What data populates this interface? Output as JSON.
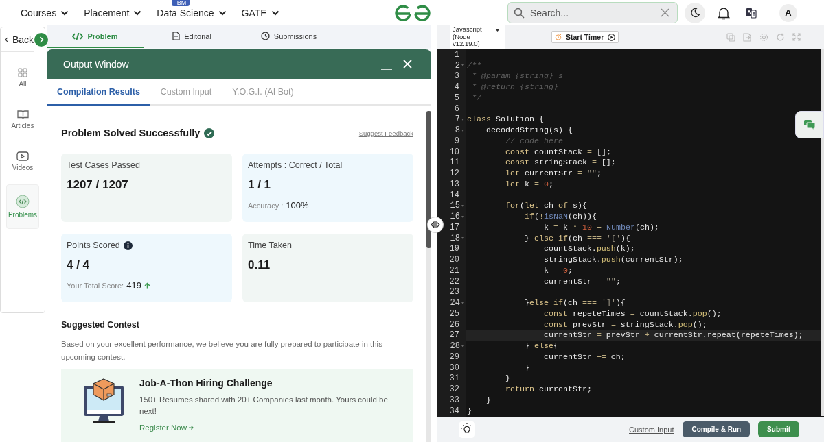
{
  "top_nav": {
    "items": [
      {
        "label": "Courses"
      },
      {
        "label": "Placement"
      },
      {
        "label": "Data Science",
        "badge": "IBM"
      },
      {
        "label": "GATE"
      }
    ],
    "search": {
      "placeholder": "Search..."
    },
    "avatar": "A"
  },
  "sidebar": {
    "back": "Back",
    "items": [
      {
        "label": "All",
        "selected": false
      },
      {
        "label": "Articles",
        "selected": false
      },
      {
        "label": "Videos",
        "selected": false
      },
      {
        "label": "Problems",
        "selected": true
      }
    ]
  },
  "problem_tabs": [
    {
      "label": "Problem",
      "selected": true
    },
    {
      "label": "Editorial",
      "selected": false
    },
    {
      "label": "Submissions",
      "selected": false
    }
  ],
  "output_window": {
    "title": "Output Window",
    "tabs": [
      {
        "label": "Compilation Results",
        "selected": true
      },
      {
        "label": "Custom Input",
        "selected": false
      },
      {
        "label": "Y.O.G.I. (AI Bot)",
        "selected": false
      }
    ],
    "status": "Problem Solved Successfully",
    "feedback_link": "Suggest Feedback",
    "stats": [
      {
        "label": "Test Cases Passed",
        "value": "1207 / 1207",
        "color": "#f1f6f4",
        "info": false
      },
      {
        "label": "Attempts : Correct / Total",
        "value": "1 / 1",
        "color": "#eef8fd",
        "info": false,
        "note_label": "Accuracy :",
        "note_value": "100%"
      },
      {
        "label": "Points Scored",
        "value": "4 / 4",
        "color": "#eef8fd",
        "info": true,
        "note_label": "Your Total Score:",
        "note_value": "419",
        "rising": true
      },
      {
        "label": "Time Taken",
        "value": "0.11",
        "color": "#f1f6f4",
        "info": false
      }
    ],
    "suggested": {
      "title": "Suggested Contest",
      "text": "Based on your excellent performance, we believe you are fully prepared to participate in this upcoming contest.",
      "contest": {
        "title": "Job-A-Thon Hiring Challenge",
        "description": "150+ Resumes shared with 20+ Companies last month. Yours could be next!",
        "link": "Register Now"
      }
    }
  },
  "editor": {
    "language": "Javascript (Node v12.19.0)",
    "timer_button": "Start Timer",
    "lines": [
      {
        "number": "1",
        "foldable": false,
        "current": false
      },
      {
        "number": "2",
        "foldable": true,
        "current": false,
        "tokens": [
          {
            "text": "/**",
            "kind": "comment"
          }
        ]
      },
      {
        "number": "3",
        "foldable": false,
        "current": false,
        "tokens": [
          {
            "text": " * @param {string} s",
            "kind": "comment"
          }
        ]
      },
      {
        "number": "4",
        "foldable": false,
        "current": false,
        "tokens": [
          {
            "text": " * @return {string}",
            "kind": "comment"
          }
        ]
      },
      {
        "number": "5",
        "foldable": false,
        "current": false,
        "tokens": [
          {
            "text": " */",
            "kind": "comment"
          }
        ]
      },
      {
        "number": "6",
        "foldable": false,
        "current": false
      },
      {
        "number": "7",
        "foldable": true,
        "current": false,
        "tokens": [
          {
            "text": "class",
            "kind": "keyword"
          },
          {
            "text": " Solution {",
            "kind": "plain"
          }
        ]
      },
      {
        "number": "8",
        "foldable": true,
        "current": false,
        "tokens": [
          {
            "text": "    decodedString(s) {",
            "kind": "plain"
          }
        ]
      },
      {
        "number": "9",
        "foldable": false,
        "current": false,
        "tokens": [
          {
            "text": "        // code here",
            "kind": "comment"
          }
        ]
      },
      {
        "number": "10",
        "foldable": false,
        "current": false,
        "tokens": [
          {
            "text": "        const",
            "kind": "keyword"
          },
          {
            "text": " countStack ",
            "kind": "plain"
          },
          {
            "text": "=",
            "kind": "op"
          },
          {
            "text": " [];",
            "kind": "plain"
          }
        ]
      },
      {
        "number": "11",
        "foldable": false,
        "current": false,
        "tokens": [
          {
            "text": "        const",
            "kind": "keyword"
          },
          {
            "text": " stringStack ",
            "kind": "plain"
          },
          {
            "text": "=",
            "kind": "op"
          },
          {
            "text": " [];",
            "kind": "plain"
          }
        ]
      },
      {
        "number": "12",
        "foldable": false,
        "current": false,
        "tokens": [
          {
            "text": "        let",
            "kind": "keyword"
          },
          {
            "text": " currentStr ",
            "kind": "plain"
          },
          {
            "text": "=",
            "kind": "op"
          },
          {
            "text": " \"\"",
            "kind": "string"
          },
          {
            "text": ";",
            "kind": "plain"
          }
        ]
      },
      {
        "number": "13",
        "foldable": false,
        "current": false,
        "tokens": [
          {
            "text": "        let",
            "kind": "keyword"
          },
          {
            "text": " k ",
            "kind": "plain"
          },
          {
            "text": "=",
            "kind": "op"
          },
          {
            "text": " 0",
            "kind": "number"
          },
          {
            "text": ";",
            "kind": "plain"
          }
        ]
      },
      {
        "number": "14",
        "foldable": false,
        "current": false
      },
      {
        "number": "15",
        "foldable": true,
        "current": false,
        "tokens": [
          {
            "text": "        for",
            "kind": "keyword"
          },
          {
            "text": "(",
            "kind": "plain"
          },
          {
            "text": "let",
            "kind": "keyword"
          },
          {
            "text": " ch ",
            "kind": "plain"
          },
          {
            "text": "of",
            "kind": "keyword"
          },
          {
            "text": " s){",
            "kind": "plain"
          }
        ]
      },
      {
        "number": "16",
        "foldable": true,
        "current": false,
        "tokens": [
          {
            "text": "            if",
            "kind": "keyword"
          },
          {
            "text": "(",
            "kind": "plain"
          },
          {
            "text": "!",
            "kind": "op"
          },
          {
            "text": "isNaN",
            "kind": "func"
          },
          {
            "text": "(ch)){",
            "kind": "plain"
          }
        ]
      },
      {
        "number": "17",
        "foldable": false,
        "current": false,
        "tokens": [
          {
            "text": "                k ",
            "kind": "plain"
          },
          {
            "text": "=",
            "kind": "op"
          },
          {
            "text": " k ",
            "kind": "plain"
          },
          {
            "text": "*",
            "kind": "op"
          },
          {
            "text": " 10",
            "kind": "number"
          },
          {
            "text": " +",
            "kind": "op"
          },
          {
            "text": " Number",
            "kind": "func"
          },
          {
            "text": "(ch);",
            "kind": "plain"
          }
        ]
      },
      {
        "number": "18",
        "foldable": true,
        "current": false,
        "tokens": [
          {
            "text": "            } ",
            "kind": "plain"
          },
          {
            "text": "else if",
            "kind": "keyword"
          },
          {
            "text": "(ch ",
            "kind": "plain"
          },
          {
            "text": "===",
            "kind": "op"
          },
          {
            "text": " '['",
            "kind": "string"
          },
          {
            "text": "){",
            "kind": "plain"
          }
        ]
      },
      {
        "number": "19",
        "foldable": false,
        "current": false,
        "tokens": [
          {
            "text": "                countStack.",
            "kind": "plain"
          },
          {
            "text": "push",
            "kind": "method"
          },
          {
            "text": "(k);",
            "kind": "plain"
          }
        ]
      },
      {
        "number": "20",
        "foldable": false,
        "current": false,
        "tokens": [
          {
            "text": "                stringStack.",
            "kind": "plain"
          },
          {
            "text": "push",
            "kind": "method"
          },
          {
            "text": "(currentStr);",
            "kind": "plain"
          }
        ]
      },
      {
        "number": "21",
        "foldable": false,
        "current": false,
        "tokens": [
          {
            "text": "                k ",
            "kind": "plain"
          },
          {
            "text": "=",
            "kind": "op"
          },
          {
            "text": " 0",
            "kind": "number"
          },
          {
            "text": ";",
            "kind": "plain"
          }
        ]
      },
      {
        "number": "22",
        "foldable": false,
        "current": false,
        "tokens": [
          {
            "text": "                currentStr ",
            "kind": "plain"
          },
          {
            "text": "=",
            "kind": "op"
          },
          {
            "text": " \"\"",
            "kind": "string"
          },
          {
            "text": ";",
            "kind": "plain"
          }
        ]
      },
      {
        "number": "23",
        "foldable": false,
        "current": false
      },
      {
        "number": "24",
        "foldable": true,
        "current": false,
        "tokens": [
          {
            "text": "            }",
            "kind": "plain"
          },
          {
            "text": "else if",
            "kind": "keyword"
          },
          {
            "text": "(ch ",
            "kind": "plain"
          },
          {
            "text": "===",
            "kind": "op"
          },
          {
            "text": " ']'",
            "kind": "string"
          },
          {
            "text": "){",
            "kind": "plain"
          }
        ]
      },
      {
        "number": "25",
        "foldable": false,
        "current": false,
        "tokens": [
          {
            "text": "                const",
            "kind": "keyword"
          },
          {
            "text": " repeteTimes ",
            "kind": "plain"
          },
          {
            "text": "=",
            "kind": "op"
          },
          {
            "text": " countStack.",
            "kind": "plain"
          },
          {
            "text": "pop",
            "kind": "method"
          },
          {
            "text": "();",
            "kind": "plain"
          }
        ]
      },
      {
        "number": "26",
        "foldable": false,
        "current": false,
        "tokens": [
          {
            "text": "                const",
            "kind": "keyword"
          },
          {
            "text": " prevStr ",
            "kind": "plain"
          },
          {
            "text": "=",
            "kind": "op"
          },
          {
            "text": " stringStack.",
            "kind": "plain"
          },
          {
            "text": "pop",
            "kind": "method"
          },
          {
            "text": "();",
            "kind": "plain"
          }
        ]
      },
      {
        "number": "27",
        "foldable": false,
        "current": true,
        "tokens": [
          {
            "text": "                currentStr ",
            "kind": "plain"
          },
          {
            "text": "=",
            "kind": "op"
          },
          {
            "text": " prevStr ",
            "kind": "plain"
          },
          {
            "text": "+",
            "kind": "op"
          },
          {
            "text": " currentStr.repeat(repeteTimes);",
            "kind": "plain"
          }
        ]
      },
      {
        "number": "28",
        "foldable": true,
        "current": false,
        "tokens": [
          {
            "text": "            } ",
            "kind": "plain"
          },
          {
            "text": "else",
            "kind": "keyword"
          },
          {
            "text": "{",
            "kind": "plain"
          }
        ]
      },
      {
        "number": "29",
        "foldable": false,
        "current": false,
        "tokens": [
          {
            "text": "                currentStr ",
            "kind": "plain"
          },
          {
            "text": "+=",
            "kind": "op"
          },
          {
            "text": " ch;",
            "kind": "plain"
          }
        ]
      },
      {
        "number": "30",
        "foldable": false,
        "current": false,
        "tokens": [
          {
            "text": "            }",
            "kind": "plain"
          }
        ]
      },
      {
        "number": "31",
        "foldable": false,
        "current": false,
        "tokens": [
          {
            "text": "        }",
            "kind": "plain"
          }
        ]
      },
      {
        "number": "32",
        "foldable": false,
        "current": false,
        "tokens": [
          {
            "text": "        return",
            "kind": "keyword"
          },
          {
            "text": " currentStr;",
            "kind": "plain"
          }
        ]
      },
      {
        "number": "33",
        "foldable": false,
        "current": false,
        "tokens": [
          {
            "text": "    }",
            "kind": "plain"
          }
        ]
      },
      {
        "number": "34",
        "foldable": false,
        "current": false,
        "tokens": [
          {
            "text": "}",
            "kind": "plain"
          }
        ]
      }
    ]
  },
  "footer": {
    "custom_input": "Custom Input",
    "buttons": [
      {
        "label": "Compile & Run",
        "kind": "secondary"
      },
      {
        "label": "Submit",
        "kind": "primary"
      }
    ]
  }
}
